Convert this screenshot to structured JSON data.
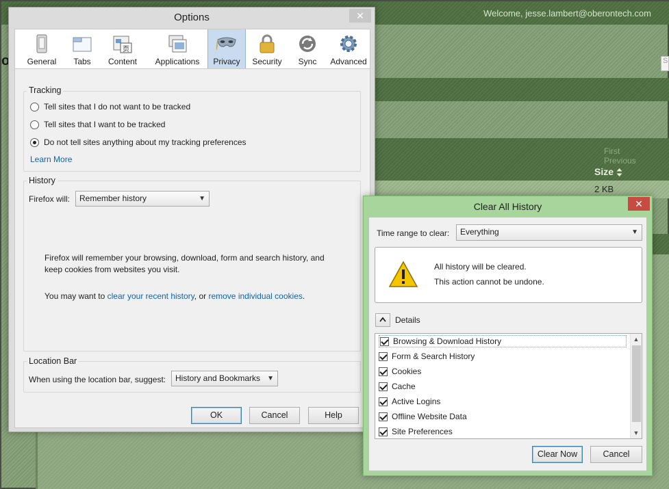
{
  "background": {
    "welcome": "Welcome, jesse.lambert@oberontech.com",
    "logo_fragment": "o",
    "pager": {
      "first": "First",
      "previous": "Previous"
    },
    "size_header": "Size",
    "size_sort_icon": "sort-arrows-icon",
    "size_value": "2 KB",
    "search_stub": "S"
  },
  "options": {
    "title": "Options",
    "close_glyph": "✕",
    "tabs": [
      {
        "label": "General",
        "icon": "general-icon"
      },
      {
        "label": "Tabs",
        "icon": "tabs-icon"
      },
      {
        "label": "Content",
        "icon": "content-icon"
      },
      {
        "label": "Applications",
        "icon": "applications-icon"
      },
      {
        "label": "Privacy",
        "icon": "privacy-mask-icon",
        "active": true
      },
      {
        "label": "Security",
        "icon": "padlock-icon"
      },
      {
        "label": "Sync",
        "icon": "sync-icon"
      },
      {
        "label": "Advanced",
        "icon": "gear-icon"
      }
    ],
    "tracking": {
      "title": "Tracking",
      "options": [
        {
          "label": "Tell sites that I do not want to be tracked",
          "selected": false
        },
        {
          "label": "Tell sites that I want to be tracked",
          "selected": false
        },
        {
          "label": "Do not tell sites anything about my tracking preferences",
          "selected": true
        }
      ],
      "learn_more": "Learn More"
    },
    "history": {
      "title": "History",
      "label": "Firefox will:",
      "value": "Remember history",
      "description": "Firefox will remember your browsing, download, form and search history, and keep cookies from websites you visit.",
      "hint_prefix": "You may want to ",
      "link1": "clear your recent history",
      "hint_middle": ", or ",
      "link2": "remove individual cookies",
      "hint_suffix": "."
    },
    "location_bar": {
      "title": "Location Bar",
      "label": "When using the location bar, suggest:",
      "value": "History and Bookmarks"
    },
    "buttons": {
      "ok": "OK",
      "cancel": "Cancel",
      "help": "Help"
    }
  },
  "clear_history": {
    "title": "Clear All History",
    "close_glyph": "✕",
    "time_range_label": "Time range to clear:",
    "time_range_value": "Everything",
    "warning_line1": "All history will be cleared.",
    "warning_line2": "This action cannot be undone.",
    "details_label": "Details",
    "items": [
      {
        "label": "Browsing & Download History",
        "checked": true
      },
      {
        "label": "Form & Search History",
        "checked": true
      },
      {
        "label": "Cookies",
        "checked": true
      },
      {
        "label": "Cache",
        "checked": true
      },
      {
        "label": "Active Logins",
        "checked": true
      },
      {
        "label": "Offline Website Data",
        "checked": true
      },
      {
        "label": "Site Preferences",
        "checked": true
      }
    ],
    "buttons": {
      "clear_now": "Clear Now",
      "cancel": "Cancel"
    }
  },
  "colors": {
    "page_green": "#56764a",
    "link_blue": "#0a63b6",
    "dialog_green": "#a7d59c",
    "close_red": "#c74a43",
    "active_tab": "#c9dbef"
  }
}
